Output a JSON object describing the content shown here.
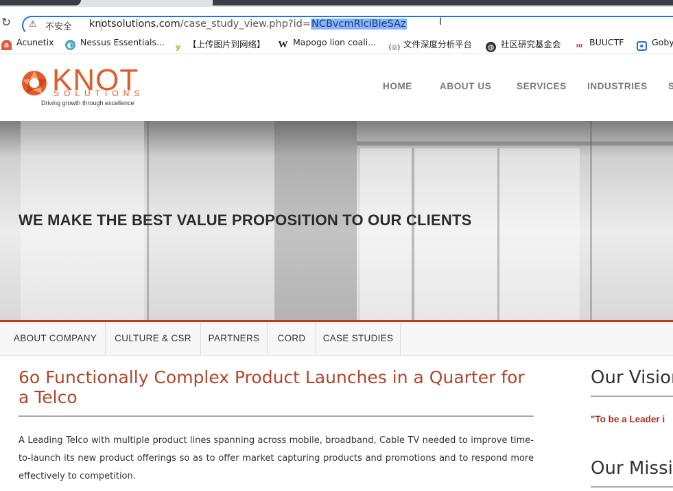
{
  "browser": {
    "security_label": "不安全",
    "url_host": "knotsolutions.com",
    "url_path": "/case_study_view.php?id=",
    "url_selected": "NCBvcmRlciBieSAz"
  },
  "bookmarks": [
    {
      "label": "Acunetix",
      "icon": "acunetix-icon"
    },
    {
      "label": "Nessus Essentials...",
      "icon": "nessus-icon"
    },
    {
      "label": "【上传图片到网络】",
      "icon": "y-icon"
    },
    {
      "label": "Mapogo lion coali...",
      "icon": "wikipedia-icon"
    },
    {
      "label": "文件深度分析平台",
      "icon": "analysis-icon"
    },
    {
      "label": "社区研究基金会",
      "icon": "globe-icon"
    },
    {
      "label": "BUUCTF",
      "icon": "buuctf-icon"
    },
    {
      "label": "Goby",
      "icon": "goby-icon"
    }
  ],
  "site": {
    "logo_word": "KNOT",
    "logo_sub": "SOLUTIONS",
    "logo_tagline": "Driving growth through excellence",
    "brand_color": "#e25a2a",
    "nav": [
      "HOME",
      "ABOUT US",
      "SERVICES",
      "INDUSTRIES",
      "S"
    ]
  },
  "hero": {
    "title": "WE MAKE THE BEST VALUE PROPOSITION TO OUR CLIENTS"
  },
  "subnav": [
    "ABOUT COMPANY",
    "CULTURE & CSR",
    "PARTNERS",
    "CORD",
    "CASE STUDIES"
  ],
  "article": {
    "title": "6o Functionally Complex Product Launches in a Quarter for a Telco",
    "body": "A Leading Telco with multiple product lines spanning across mobile, broadband, Cable TV needed to improve time-to-launch its new product offerings so as to offer market capturing products and promotions and to respond more effectively to competition."
  },
  "sidebar": {
    "vision_heading": "Our Vision",
    "vision_quote": "\"To be a Leader i",
    "mission_heading": "Our Missio"
  }
}
